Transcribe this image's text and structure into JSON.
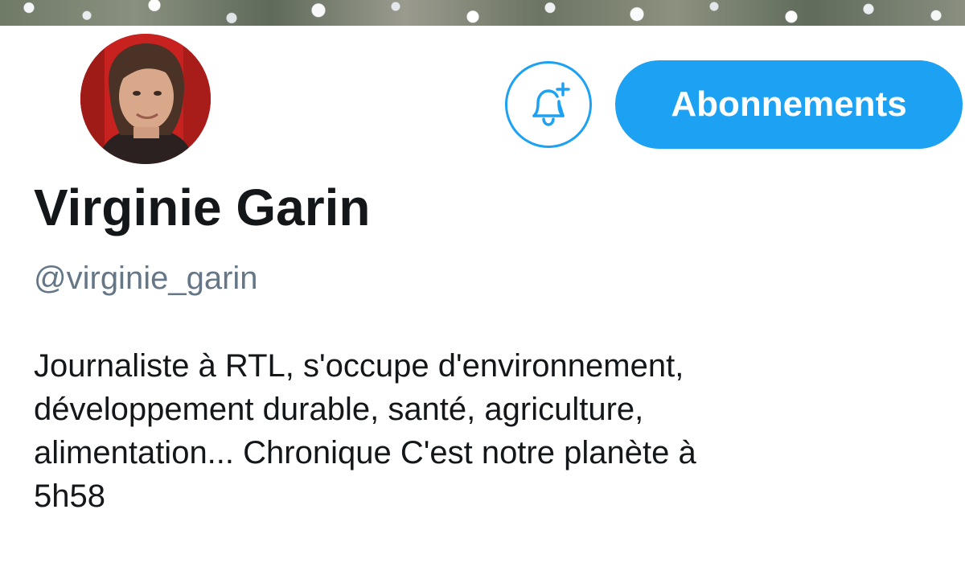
{
  "profile": {
    "name": "Virginie Garin",
    "handle": "@virginie_garin",
    "bio_lines": [
      "Journaliste à RTL, s'occupe d'environnement,",
      "développement durable, santé, agriculture,",
      "alimentation... Chronique C'est notre planète à",
      "5h58"
    ]
  },
  "actions": {
    "notifications_icon": "bell-plus-icon",
    "follow_label": "Abonnements"
  },
  "colors": {
    "accent": "#1da1f2",
    "text_primary": "#14171a",
    "text_secondary": "#657786",
    "avatar_background": "#c7221f"
  }
}
